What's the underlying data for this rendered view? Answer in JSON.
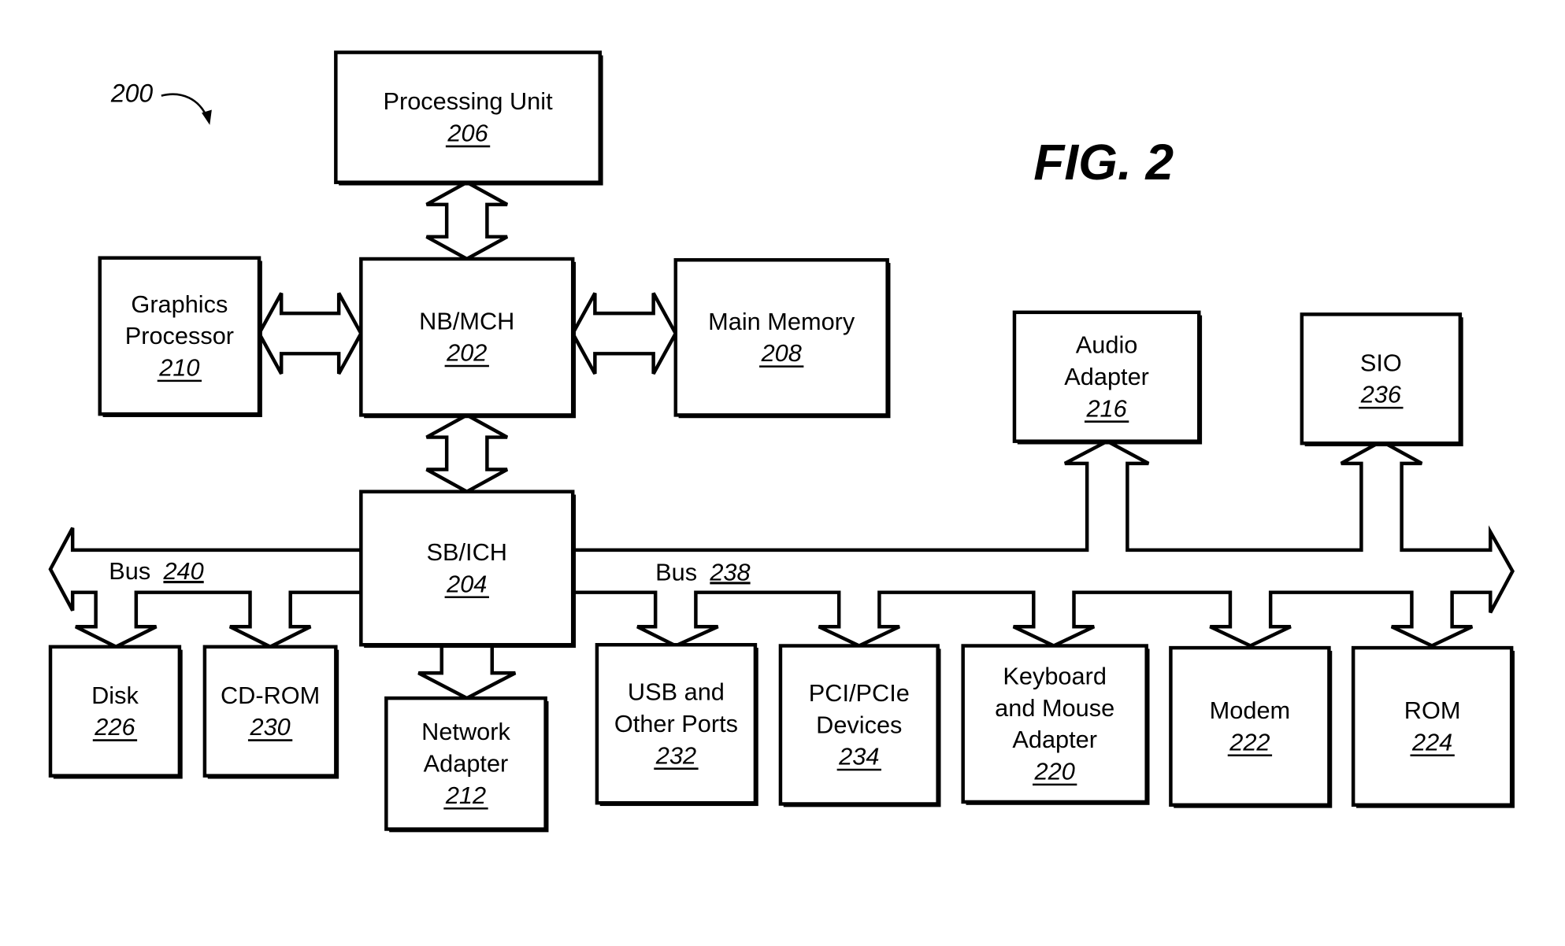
{
  "figure": {
    "title": "FIG. 2",
    "reference": "200"
  },
  "components": [
    {
      "id": "processing-unit",
      "lines": [
        "Processing Unit"
      ],
      "ref": "206"
    },
    {
      "id": "nb-mch",
      "lines": [
        "NB/MCH"
      ],
      "ref": "202"
    },
    {
      "id": "graphics-processor",
      "lines": [
        "Graphics",
        "Processor"
      ],
      "ref": "210"
    },
    {
      "id": "main-memory",
      "lines": [
        "Main Memory"
      ],
      "ref": "208"
    },
    {
      "id": "sb-ich",
      "lines": [
        "SB/ICH"
      ],
      "ref": "204"
    },
    {
      "id": "audio-adapter",
      "lines": [
        "Audio",
        "Adapter"
      ],
      "ref": "216"
    },
    {
      "id": "sio",
      "lines": [
        "SIO"
      ],
      "ref": "236"
    },
    {
      "id": "disk",
      "lines": [
        "Disk"
      ],
      "ref": "226"
    },
    {
      "id": "cd-rom",
      "lines": [
        "CD-ROM"
      ],
      "ref": "230"
    },
    {
      "id": "network-adapter",
      "lines": [
        "Network",
        "Adapter"
      ],
      "ref": "212"
    },
    {
      "id": "usb-ports",
      "lines": [
        "USB and",
        "Other Ports"
      ],
      "ref": "232"
    },
    {
      "id": "pci-devices",
      "lines": [
        "PCI/PCIe",
        "Devices"
      ],
      "ref": "234"
    },
    {
      "id": "keyboard-mouse-adapter",
      "lines": [
        "Keyboard",
        "and Mouse",
        "Adapter"
      ],
      "ref": "220"
    },
    {
      "id": "modem",
      "lines": [
        "Modem"
      ],
      "ref": "222"
    },
    {
      "id": "rom",
      "lines": [
        "ROM"
      ],
      "ref": "224"
    }
  ],
  "buses": [
    {
      "id": "bus-240",
      "label": "Bus",
      "ref": "240"
    },
    {
      "id": "bus-238",
      "label": "Bus",
      "ref": "238"
    }
  ],
  "connections": [
    {
      "from": "processing-unit",
      "to": "nb-mch",
      "direction": "bidirectional"
    },
    {
      "from": "graphics-processor",
      "to": "nb-mch",
      "direction": "bidirectional"
    },
    {
      "from": "nb-mch",
      "to": "main-memory",
      "direction": "bidirectional"
    },
    {
      "from": "nb-mch",
      "to": "sb-ich",
      "direction": "bidirectional"
    },
    {
      "from": "sb-ich",
      "to": "network-adapter",
      "direction": "to"
    },
    {
      "from": "bus-240",
      "to": "disk",
      "direction": "to"
    },
    {
      "from": "bus-240",
      "to": "cd-rom",
      "direction": "to"
    },
    {
      "from": "bus-238",
      "to": "usb-ports",
      "direction": "to"
    },
    {
      "from": "bus-238",
      "to": "pci-devices",
      "direction": "to"
    },
    {
      "from": "bus-238",
      "to": "keyboard-mouse-adapter",
      "direction": "to"
    },
    {
      "from": "bus-238",
      "to": "modem",
      "direction": "to"
    },
    {
      "from": "bus-238",
      "to": "rom",
      "direction": "to"
    },
    {
      "from": "bus-238",
      "to": "audio-adapter",
      "direction": "to"
    },
    {
      "from": "bus-238",
      "to": "sio",
      "direction": "to"
    }
  ]
}
